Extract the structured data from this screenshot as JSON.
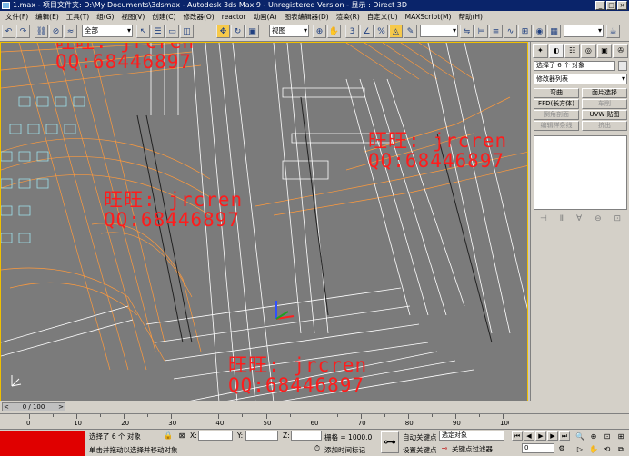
{
  "window": {
    "title": "1.max  - 项目文件夹: D:\\My Documents\\3dsmax  - Autodesk 3ds Max 9  - Unregistered Version  - 显示 : Direct 3D",
    "buttons": [
      "_",
      "□",
      "×"
    ]
  },
  "menu": [
    "文件(F)",
    "编辑(E)",
    "工具(T)",
    "组(G)",
    "视图(V)",
    "创建(C)",
    "修改器(O)",
    "reactor",
    "动画(A)",
    "图表编辑器(D)",
    "渲染(R)",
    "自定义(U)",
    "MAXScript(M)",
    "帮助(H)"
  ],
  "toolbar": {
    "selection_filter": "全部",
    "reference_coord": "视图",
    "named_selection": ""
  },
  "watermarks": [
    {
      "line1": "旺旺: jrcren",
      "line2": "QQ:68446897"
    },
    {
      "line1": "旺旺: jrcren",
      "line2": "QQ:68446897"
    },
    {
      "line1": "旺旺: jrcren",
      "line2": "QQ:68446897"
    },
    {
      "line1": "旺旺: jrcren",
      "line2": "QQ:68446897"
    }
  ],
  "command_panel": {
    "name_field": "选择了 6 个 对象",
    "modifier_list": "修改器列表",
    "buttons": [
      {
        "label": "弯曲",
        "enabled": true
      },
      {
        "label": "面片选择",
        "enabled": true
      },
      {
        "label": "FFD(长方体)",
        "enabled": true
      },
      {
        "label": "车削",
        "enabled": false
      },
      {
        "label": "倒角剖面",
        "enabled": false
      },
      {
        "label": "UVW 贴图",
        "enabled": true
      },
      {
        "label": "编辑样条线",
        "enabled": false
      },
      {
        "label": "挤出",
        "enabled": false
      }
    ]
  },
  "timeline": {
    "slider_label": "0 / 100",
    "ruler_ticks": [
      "0",
      "10",
      "20",
      "30",
      "40",
      "50",
      "60",
      "70",
      "80",
      "90",
      "100"
    ]
  },
  "status": {
    "selection": "选择了 6 个 对象",
    "prompt": "单击并拖动以选择并移动对象",
    "x_label": "X:",
    "y_label": "Y:",
    "z_label": "Z:",
    "grid": "栅格 = 1000.0",
    "add_time_tag": "添加时间标记",
    "auto_key": "自动关键点",
    "set_key": "设置关键点",
    "selected_object": "选定对象",
    "key_filters": "关键点过滤器...",
    "frame": "0"
  }
}
